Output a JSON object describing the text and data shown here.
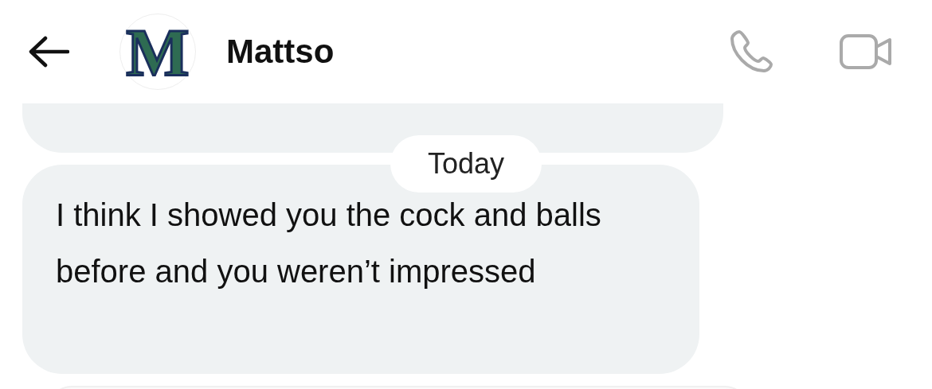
{
  "header": {
    "contact_name": "Mattso",
    "avatar_letter": "M"
  },
  "messages": [
    {
      "kind": "cut"
    },
    {
      "kind": "date",
      "text": "Today"
    },
    {
      "kind": "received",
      "text": "I think I showed you the cock and balls before and you weren’t impressed"
    },
    {
      "kind": "next"
    }
  ]
}
